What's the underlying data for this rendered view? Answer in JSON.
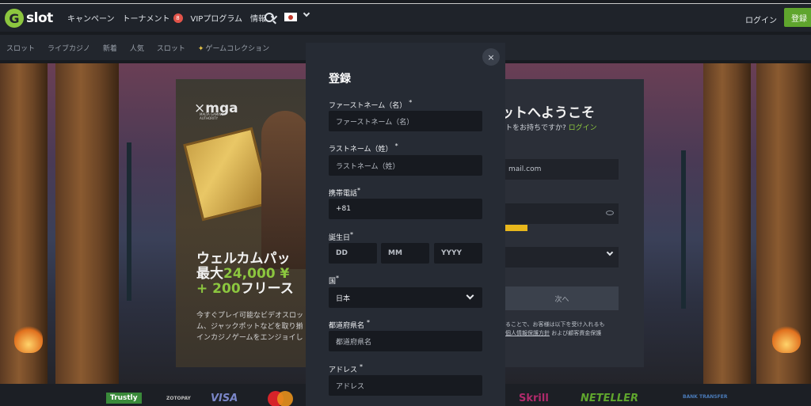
{
  "header": {
    "logo_letter": "G",
    "logo_text": "slot",
    "nav": [
      {
        "label": "キャンペーン"
      },
      {
        "label": "トーナメント",
        "badge": "8"
      },
      {
        "label": "VIPプログラム"
      },
      {
        "label": "情報"
      }
    ],
    "login_label": "ログイン",
    "register_label": "登録"
  },
  "categories": [
    "スロット",
    "ライブカジノ",
    "新着",
    "人気",
    "スロット",
    "ゲームコレクション"
  ],
  "promo": {
    "mga_logo": "mga",
    "mga_sub": "MALTA GAMING AUTHORITY",
    "title_line1": "ウェルカムパッ",
    "title_line2_prefix": "最大",
    "title_line2_amount": "24,000 ¥",
    "title_line3_prefix": "+ 200",
    "title_line3_suffix": "フリース",
    "body_line1": "今すぐプレイ可能なビデオスロッ",
    "body_line2": "ム、ジャックポットなどを取り揃",
    "body_line3": "インカジノゲームをエンジョイし"
  },
  "login_panel": {
    "welcome": "ットへようこそ",
    "have_account": "トをお持ちですか?",
    "login_link": "ログイン",
    "email_placeholder": "mail.com",
    "next_label": "次へ",
    "terms_line1": "ることで、お客様は以下を受け入れるも",
    "terms_link": "個人情報保護方針",
    "terms_line2_suffix": "および顧客資金保護"
  },
  "payments": [
    "Trustly",
    "ZOTOPAY",
    "VISA",
    "Skrill",
    "NETELLER",
    "BANK TRANSFER"
  ],
  "modal": {
    "title": "登録",
    "close_icon": "×",
    "fields": {
      "first_name": {
        "label": "ファーストネーム（名）",
        "placeholder": "ファーストネーム（名）"
      },
      "last_name": {
        "label": "ラストネーム（姓）",
        "placeholder": "ラストネーム（姓）"
      },
      "phone": {
        "label": "携帯電話",
        "value": "+81"
      },
      "dob": {
        "label": "誕生日",
        "day": "DD",
        "month": "MM",
        "year": "YYYY"
      },
      "country": {
        "label": "国",
        "value": "日本"
      },
      "prefecture": {
        "label": "都道府県名",
        "placeholder": "都道府県名"
      },
      "address": {
        "label": "アドレス",
        "placeholder": "アドレス"
      }
    },
    "required_mark": "*"
  },
  "colors": {
    "accent_green": "#8cc63f",
    "button_green": "#5fa52d",
    "modal_bg": "#262b34",
    "input_bg": "#171a20"
  }
}
